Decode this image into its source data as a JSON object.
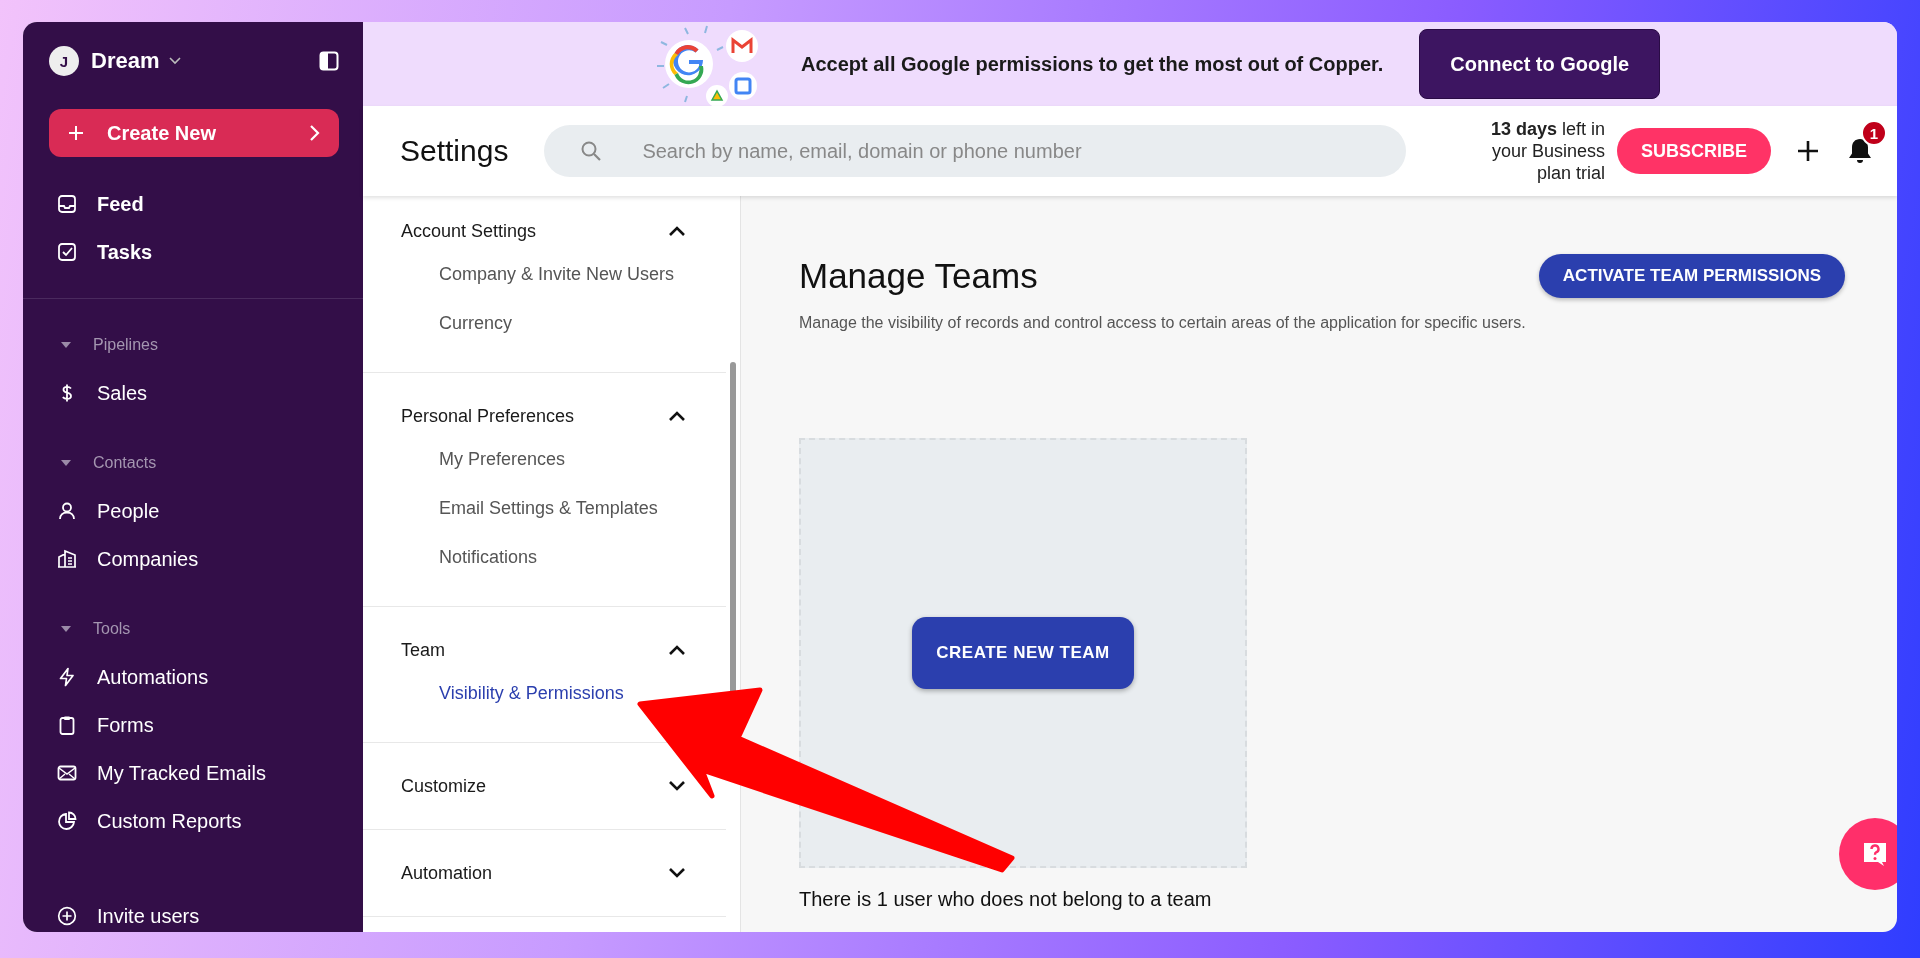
{
  "sidebar": {
    "workspace": {
      "initial": "J",
      "name": "Dream"
    },
    "create_button": "Create New",
    "primary": [
      {
        "label": "Feed"
      },
      {
        "label": "Tasks"
      }
    ],
    "sections": [
      {
        "label": "Pipelines",
        "expanded": true,
        "items": [
          {
            "label": "Sales"
          }
        ]
      },
      {
        "label": "Contacts",
        "expanded": true,
        "items": [
          {
            "label": "People"
          },
          {
            "label": "Companies"
          }
        ]
      },
      {
        "label": "Tools",
        "expanded": true,
        "items": [
          {
            "label": "Automations"
          },
          {
            "label": "Forms"
          },
          {
            "label": "My Tracked Emails"
          },
          {
            "label": "Custom Reports"
          }
        ]
      }
    ],
    "footer": {
      "label": "Invite users"
    }
  },
  "banner": {
    "message": "Accept all Google permissions to get the most out of Copper.",
    "button": "Connect to Google"
  },
  "header": {
    "title": "Settings",
    "search": {
      "placeholder": "Search by name, email, domain or phone number"
    },
    "trial": "**13 days** left in your Business plan trial",
    "subscribe": "SUBSCRIBE",
    "notifications": "1"
  },
  "settings_nav": [
    {
      "title": "Account Settings",
      "expanded": true,
      "items": [
        {
          "label": "Company & Invite New Users",
          "selected": false
        },
        {
          "label": "Currency",
          "selected": false
        }
      ]
    },
    {
      "title": "Personal Preferences",
      "expanded": true,
      "items": [
        {
          "label": "My Preferences",
          "selected": false
        },
        {
          "label": "Email Settings & Templates",
          "selected": false
        },
        {
          "label": "Notifications",
          "selected": false
        }
      ]
    },
    {
      "title": "Team",
      "expanded": true,
      "items": [
        {
          "label": "Visibility & Permissions",
          "selected": true
        }
      ]
    },
    {
      "title": "Customize",
      "expanded": false
    },
    {
      "title": "Automation",
      "expanded": false
    }
  ],
  "main": {
    "title": "Manage Teams",
    "description": "Manage the visibility of records and control access to certain areas of the application for specific users.",
    "activate_button": "ACTIVATE TEAM PERMISSIONS",
    "create_button": "CREATE NEW TEAM",
    "footer_text": "There is 1 user who does not belong to a team"
  }
}
